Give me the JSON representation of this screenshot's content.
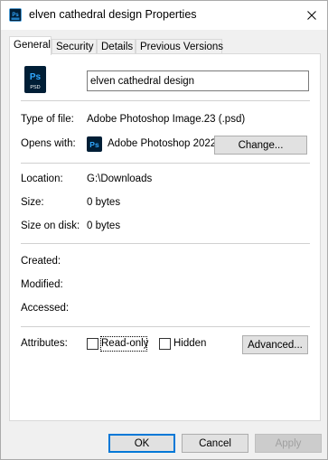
{
  "window": {
    "title": "elven cathedral design Properties",
    "icon": "photoshop-file-icon"
  },
  "tabs": [
    {
      "label": "General",
      "active": true
    },
    {
      "label": "Security",
      "active": false
    },
    {
      "label": "Details",
      "active": false
    },
    {
      "label": "Previous Versions",
      "active": false
    }
  ],
  "general": {
    "file_name": "elven cathedral design",
    "file_icon_text": "Ps",
    "file_icon_subtext": "PSD",
    "type_label": "Type of file:",
    "type_value": "Adobe Photoshop Image.23 (.psd)",
    "opens_label": "Opens with:",
    "opens_value": "Adobe Photoshop 2022",
    "app_icon_text": "Ps",
    "change_button": "Change...",
    "location_label": "Location:",
    "location_value": "G:\\Downloads",
    "size_label": "Size:",
    "size_value": "0 bytes",
    "size_on_disk_label": "Size on disk:",
    "size_on_disk_value": "0 bytes",
    "created_label": "Created:",
    "modified_label": "Modified:",
    "accessed_label": "Accessed:",
    "attributes_label": "Attributes:",
    "readonly_label": "Read-only",
    "readonly_checked": false,
    "hidden_label": "Hidden",
    "hidden_checked": false,
    "advanced_button": "Advanced..."
  },
  "footer": {
    "ok": "OK",
    "cancel": "Cancel",
    "apply": "Apply"
  },
  "colors": {
    "photoshop_bg": "#001e36",
    "photoshop_fg": "#31a8ff",
    "default_button_border": "#0078d7"
  }
}
